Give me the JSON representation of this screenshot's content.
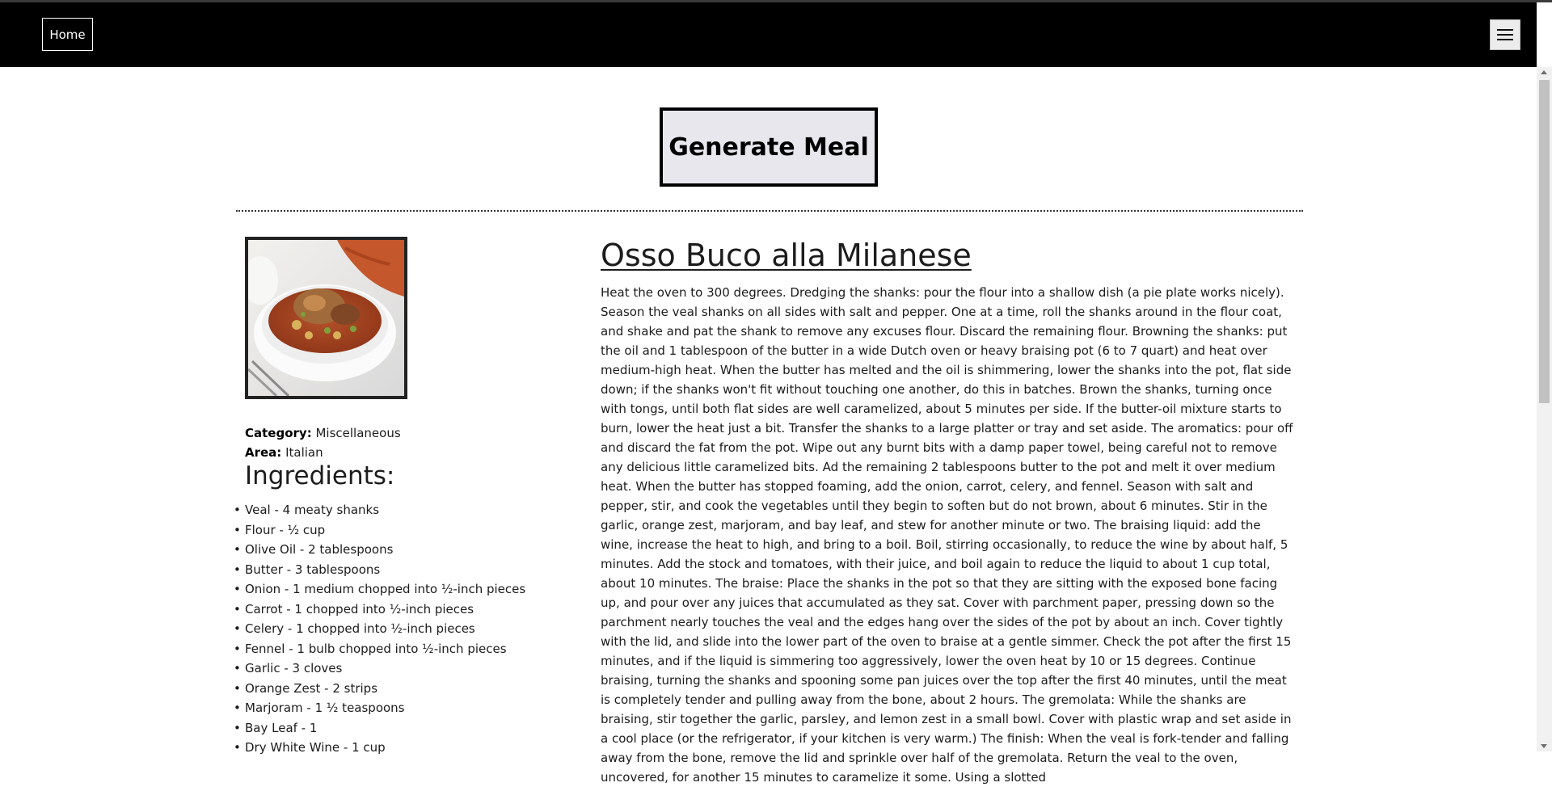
{
  "nav": {
    "home_label": "Home",
    "menu_icon": "hamburger-icon"
  },
  "generate": {
    "label": "Generate Meal"
  },
  "meal": {
    "title": "Osso Buco alla Milanese",
    "image_alt": "Osso Buco alla Milanese",
    "category_label": "Category:",
    "category": "Miscellaneous",
    "area_label": "Area:",
    "area": "Italian",
    "ingredients_title": "Ingredients:",
    "ingredients": [
      "Veal - 4 meaty shanks",
      "Flour - ½ cup",
      "Olive Oil - 2 tablespoons",
      "Butter - 3 tablespoons",
      "Onion - 1 medium chopped into ½-inch pieces",
      "Carrot - 1 chopped into ½-inch pieces",
      "Celery - 1 chopped into ½-inch pieces",
      "Fennel - 1 bulb chopped into ½-inch pieces",
      "Garlic - 3 cloves",
      "Orange Zest - 2 strips",
      "Marjoram - 1 ½ teaspoons",
      "Bay Leaf - 1",
      "Dry White Wine - 1 cup"
    ],
    "instructions": "Heat the oven to 300 degrees. Dredging the shanks: pour the flour into a shallow dish (a pie plate works nicely). Season the veal shanks on all sides with salt and pepper. One at a time, roll the shanks around in the flour coat, and shake and pat the shank to remove any excuses flour. Discard the remaining flour. Browning the shanks: put the oil and 1 tablespoon of the butter in a wide Dutch oven or heavy braising pot (6 to 7 quart) and heat over medium-high heat. When the butter has melted and the oil is shimmering, lower the shanks into the pot, flat side down; if the shanks won't fit without touching one another, do this in batches. Brown the shanks, turning once with tongs, until both flat sides are well caramelized, about 5 minutes per side. If the butter-oil mixture starts to burn, lower the heat just a bit. Transfer the shanks to a large platter or tray and set aside. The aromatics: pour off and discard the fat from the pot. Wipe out any burnt bits with a damp paper towel, being careful not to remove any delicious little caramelized bits. Ad the remaining 2 tablespoons butter to the pot and melt it over medium heat. When the butter has stopped foaming, add the onion, carrot, celery, and fennel. Season with salt and pepper, stir, and cook the vegetables until they begin to soften but do not brown, about 6 minutes. Stir in the garlic, orange zest, marjoram, and bay leaf, and stew for another minute or two. The braising liquid: add the wine, increase the heat to high, and bring to a boil. Boil, stirring occasionally, to reduce the wine by about half, 5 minutes. Add the stock and tomatoes, with their juice, and boil again to reduce the liquid to about 1 cup total, about 10 minutes. The braise: Place the shanks in the pot so that they are sitting with the exposed bone facing up, and pour over any juices that accumulated as they sat. Cover with parchment paper, pressing down so the parchment nearly touches the veal and the edges hang over the sides of the pot by about an inch. Cover tightly with the lid, and slide into the lower part of the oven to braise at a gentle simmer. Check the pot after the first 15 minutes, and if the liquid is simmering too aggressively, lower the oven heat by 10 or 15 degrees. Continue braising, turning the shanks and spooning some pan juices over the top after the first 40 minutes, until the meat is completely tender and pulling away from the bone, about 2 hours. The gremolata: While the shanks are braising, stir together the garlic, parsley, and lemon zest in a small bowl. Cover with plastic wrap and set aside in a cool place (or the refrigerator, if your kitchen is very warm.) The finish: When the veal is fork-tender and falling away from the bone, remove the lid and sprinkle over half of the gremolata. Return the veal to the oven, uncovered, for another 15 minutes to caramelize it some. Using a slotted"
  }
}
